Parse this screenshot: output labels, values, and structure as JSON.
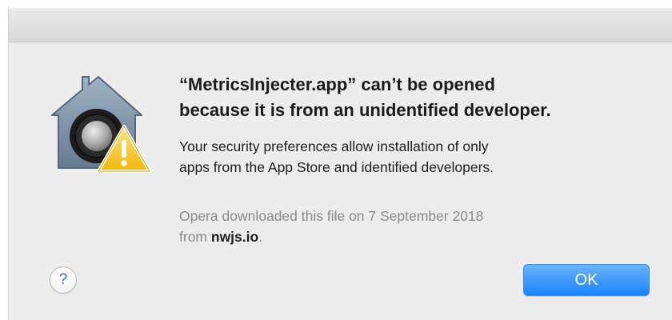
{
  "dialog": {
    "heading_line1": "“MetricsInjecter.app” can’t be opened",
    "heading_line2": "because it is from an unidentified developer.",
    "message_line1": "Your security preferences allow installation of only",
    "message_line2": "apps from the App Store and identified developers.",
    "download_info_line1": "Opera downloaded this file on 7 September 2018",
    "download_info_from": "from ",
    "download_source": "nwjs.io",
    "download_info_end": ".",
    "icon": "gatekeeper-warning-icon"
  },
  "buttons": {
    "help_label": "?",
    "ok_label": "OK"
  },
  "colors": {
    "accent": "#1a82fb",
    "background": "#ececec",
    "warning": "#f5c11c"
  }
}
